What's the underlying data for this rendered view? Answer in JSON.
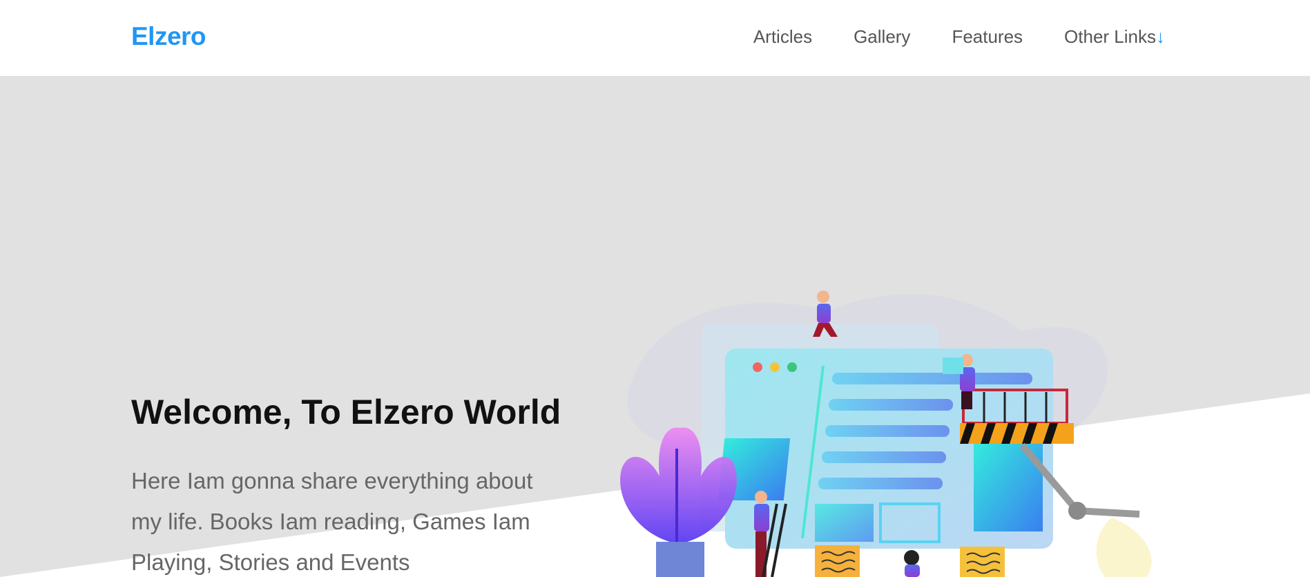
{
  "header": {
    "logo": "Elzero",
    "nav": [
      {
        "label": "Articles"
      },
      {
        "label": "Gallery"
      },
      {
        "label": "Features"
      },
      {
        "label": "Other Links",
        "icon": "arrow-down-icon"
      }
    ]
  },
  "hero": {
    "title": "Welcome, To Elzero World",
    "description": "Here Iam gonna share everything about my life. Books Iam reading, Games Iam Playing, Stories and Events"
  },
  "colors": {
    "brand": "#2196f3",
    "hero_bg": "#e1e1e1",
    "text_muted": "#666666"
  }
}
